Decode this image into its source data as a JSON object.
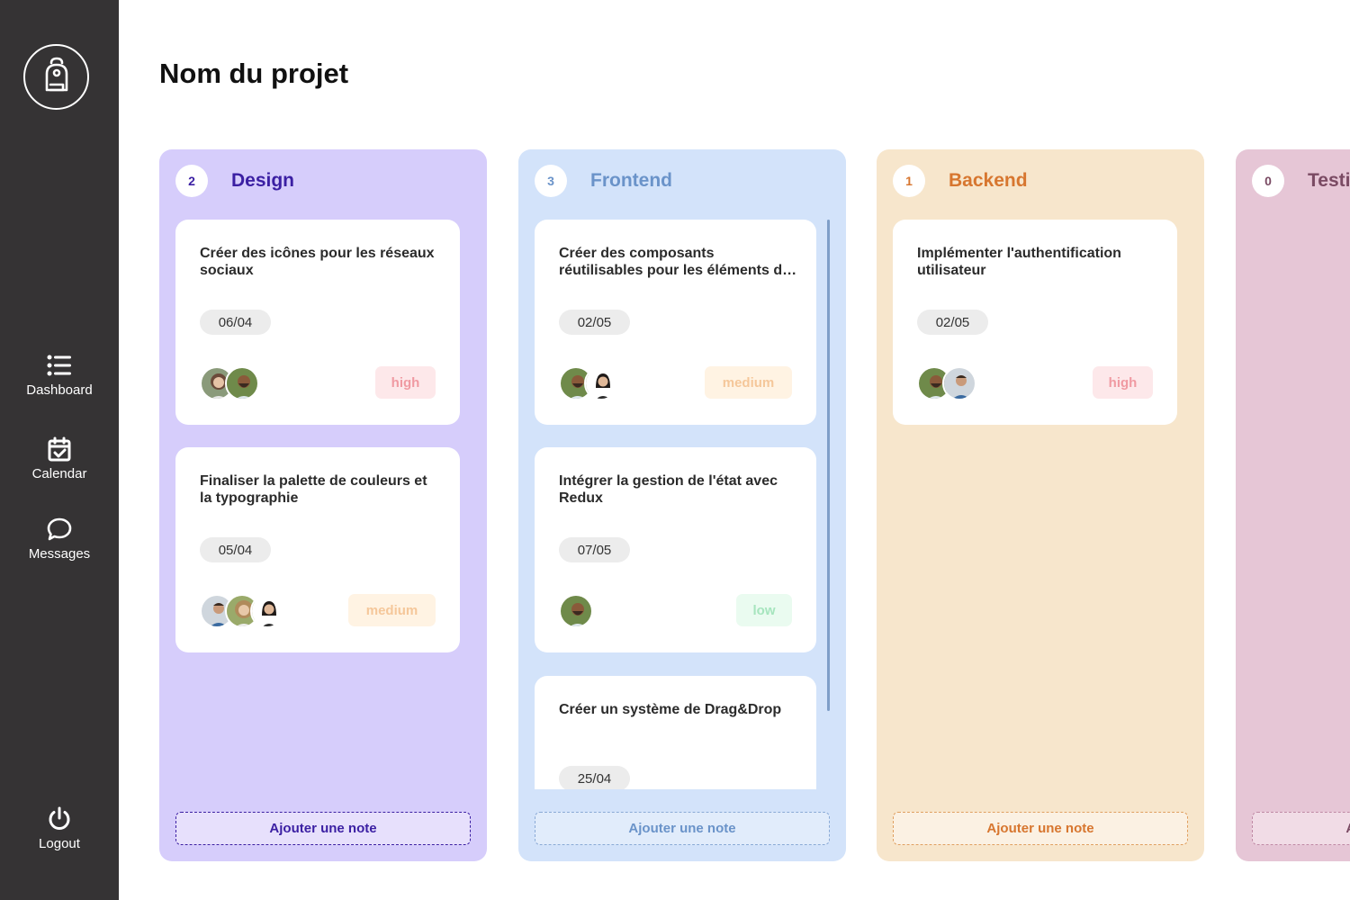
{
  "page": {
    "title": "Nom du projet"
  },
  "sidebar": {
    "logo_icon": "backpack-icon",
    "items": [
      {
        "label": "Dashboard",
        "icon": "list-icon"
      },
      {
        "label": "Calendar",
        "icon": "calendar-check-icon"
      },
      {
        "label": "Messages",
        "icon": "chat-bubble-icon"
      }
    ],
    "logout": {
      "label": "Logout",
      "icon": "power-icon"
    }
  },
  "priority_colors": {
    "high": {
      "bg": "#fde8ea",
      "text": "#f09aa2"
    },
    "medium": {
      "bg": "#fff3e3",
      "text": "#f5c79a"
    },
    "low": {
      "bg": "#eafbf0",
      "text": "#a6e5be"
    }
  },
  "columns": [
    {
      "name": "Design",
      "count": "2",
      "bg": "#d6cdfb",
      "accent": "#3b1fa3",
      "add_bg": "#e7e0fc",
      "add_label": "Ajouter une note",
      "cards": [
        {
          "title": "Créer des icônes pour les réseaux sociaux",
          "date": "06/04",
          "priority": "high",
          "avatars": [
            "avatar-woman-curly",
            "avatar-man-beard"
          ]
        },
        {
          "title": "Finaliser la palette de couleurs et la typographie",
          "date": "05/04",
          "priority": "medium",
          "avatars": [
            "avatar-man-shirt",
            "avatar-woman-curly",
            "avatar-woman-dark"
          ]
        }
      ]
    },
    {
      "name": "Frontend",
      "count": "3",
      "bg": "#d3e3fa",
      "accent": "#6a93c9",
      "add_bg": "#e1ecfb",
      "add_label": "Ajouter une note",
      "cards": [
        {
          "title": "Créer des composants réutilisables pour les éléments de l'interface",
          "date": "02/05",
          "priority": "medium",
          "avatars": [
            "avatar-man-beard",
            "avatar-woman-dark"
          ]
        },
        {
          "title": "Intégrer la gestion de l'état avec Redux",
          "date": "07/05",
          "priority": "low",
          "avatars": [
            "avatar-man-beard"
          ]
        },
        {
          "title": "Créer un système de Drag&Drop",
          "date": "25/04",
          "priority": "",
          "avatars": []
        }
      ]
    },
    {
      "name": "Backend",
      "count": "1",
      "bg": "#f7e6cc",
      "accent": "#d7762f",
      "add_bg": "#fbf1e3",
      "add_label": "Ajouter une note",
      "cards": [
        {
          "title": "Implémenter l'authentification utilisateur",
          "date": "02/05",
          "priority": "high",
          "avatars": [
            "avatar-man-beard",
            "avatar-man-shirt"
          ]
        }
      ]
    },
    {
      "name": "Testing",
      "count": "0",
      "bg": "#e6c6d6",
      "accent": "#7a4a63",
      "add_bg": "#f1dce6",
      "add_label": "Ajouter une note",
      "cards": []
    }
  ]
}
